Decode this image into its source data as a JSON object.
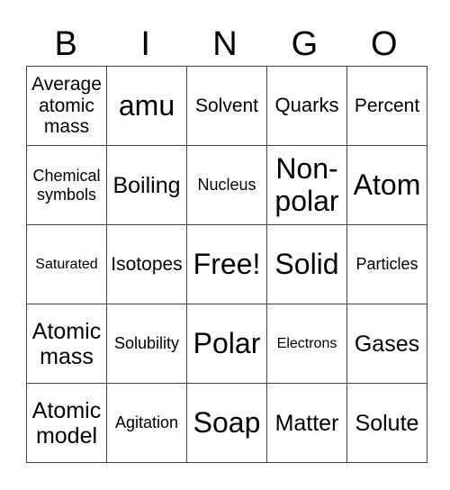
{
  "header": {
    "letters": [
      "B",
      "I",
      "N",
      "G",
      "O"
    ]
  },
  "board": {
    "rows": [
      [
        "Average atomic mass",
        "amu",
        "Solvent",
        "Quarks",
        "Percent"
      ],
      [
        "Chemical symbols",
        "Boiling",
        "Nucleus",
        "Non-polar",
        "Atom"
      ],
      [
        "Saturated",
        "Isotopes",
        "Free!",
        "Solid",
        "Particles"
      ],
      [
        "Atomic mass",
        "Solubility",
        "Polar",
        "Electrons",
        "Gases"
      ],
      [
        "Atomic model",
        "Agitation",
        "Soap",
        "Matter",
        "Solute"
      ]
    ],
    "free_space": "Free!"
  }
}
